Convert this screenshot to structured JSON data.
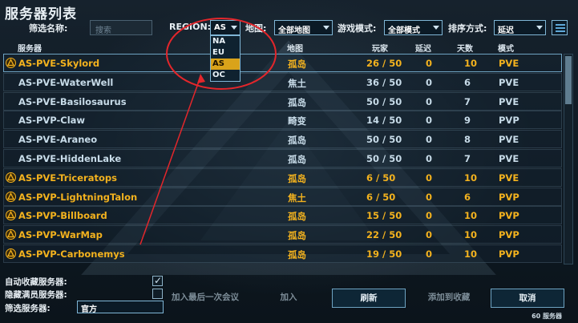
{
  "title": "服务器列表",
  "filters": {
    "name_label": "筛选名称:",
    "search_placeholder": "搜索",
    "region_label": "REGION:",
    "region_value": "AS",
    "map_label": "地图:",
    "map_value": "全部地图",
    "mode_label": "游戏模式:",
    "mode_value": "全部模式",
    "sort_label": "排序方式:",
    "sort_value": "延迟"
  },
  "region_dropdown": [
    "NA",
    "EU",
    "AS",
    "OC"
  ],
  "region_selected": "AS",
  "columns": {
    "server": "服务器",
    "map": "地图",
    "players": "玩家",
    "latency": "延迟",
    "days": "天数",
    "mode": "模式"
  },
  "rows": [
    {
      "name": "AS-PVE-Skylord",
      "map": "孤岛",
      "players": "26 / 50",
      "latency": "0",
      "days": "10",
      "mode": "PVE",
      "official": true
    },
    {
      "name": "AS-PVE-WaterWell",
      "map": "焦土",
      "players": "36 / 50",
      "latency": "0",
      "days": "6",
      "mode": "PVE",
      "official": false
    },
    {
      "name": "AS-PVE-Basilosaurus",
      "map": "孤岛",
      "players": "50 / 50",
      "latency": "0",
      "days": "7",
      "mode": "PVE",
      "official": false
    },
    {
      "name": "AS-PVP-Claw",
      "map": "畸变",
      "players": "14 / 50",
      "latency": "0",
      "days": "9",
      "mode": "PVP",
      "official": false
    },
    {
      "name": "AS-PVE-Araneo",
      "map": "孤岛",
      "players": "50 / 50",
      "latency": "0",
      "days": "8",
      "mode": "PVE",
      "official": false
    },
    {
      "name": "AS-PVE-HiddenLake",
      "map": "孤岛",
      "players": "50 / 50",
      "latency": "0",
      "days": "7",
      "mode": "PVE",
      "official": false
    },
    {
      "name": "AS-PVE-Triceratops",
      "map": "孤岛",
      "players": "6 / 50",
      "latency": "0",
      "days": "10",
      "mode": "PVE",
      "official": true
    },
    {
      "name": "AS-PVP-LightningTalon",
      "map": "焦土",
      "players": "6 / 50",
      "latency": "0",
      "days": "6",
      "mode": "PVP",
      "official": true
    },
    {
      "name": "AS-PVP-Billboard",
      "map": "孤岛",
      "players": "15 / 50",
      "latency": "0",
      "days": "10",
      "mode": "PVP",
      "official": true
    },
    {
      "name": "AS-PVP-WarMap",
      "map": "孤岛",
      "players": "22 / 50",
      "latency": "0",
      "days": "10",
      "mode": "PVP",
      "official": true
    },
    {
      "name": "AS-PVP-Carbonemys",
      "map": "孤岛",
      "players": "19 / 50",
      "latency": "0",
      "days": "10",
      "mode": "PVP",
      "official": true
    }
  ],
  "bottom": {
    "auto_fav_label": "自动收藏服务器:",
    "hide_full_label": "隐藏满员服务器:",
    "filter_server_label": "筛选服务器:",
    "filter_server_value": "官方",
    "join_last_label": "加入最后一次会议",
    "join_label": "加入",
    "refresh_label": "刷新",
    "add_fav_label": "添加到收藏",
    "cancel_label": "取消",
    "server_count": "60 服务器"
  },
  "colors": {
    "official_text": "#f3b21e",
    "regular_text": "#c7dbe8",
    "accent_border": "#7fb6d6",
    "annotation_red": "#e3262b"
  }
}
